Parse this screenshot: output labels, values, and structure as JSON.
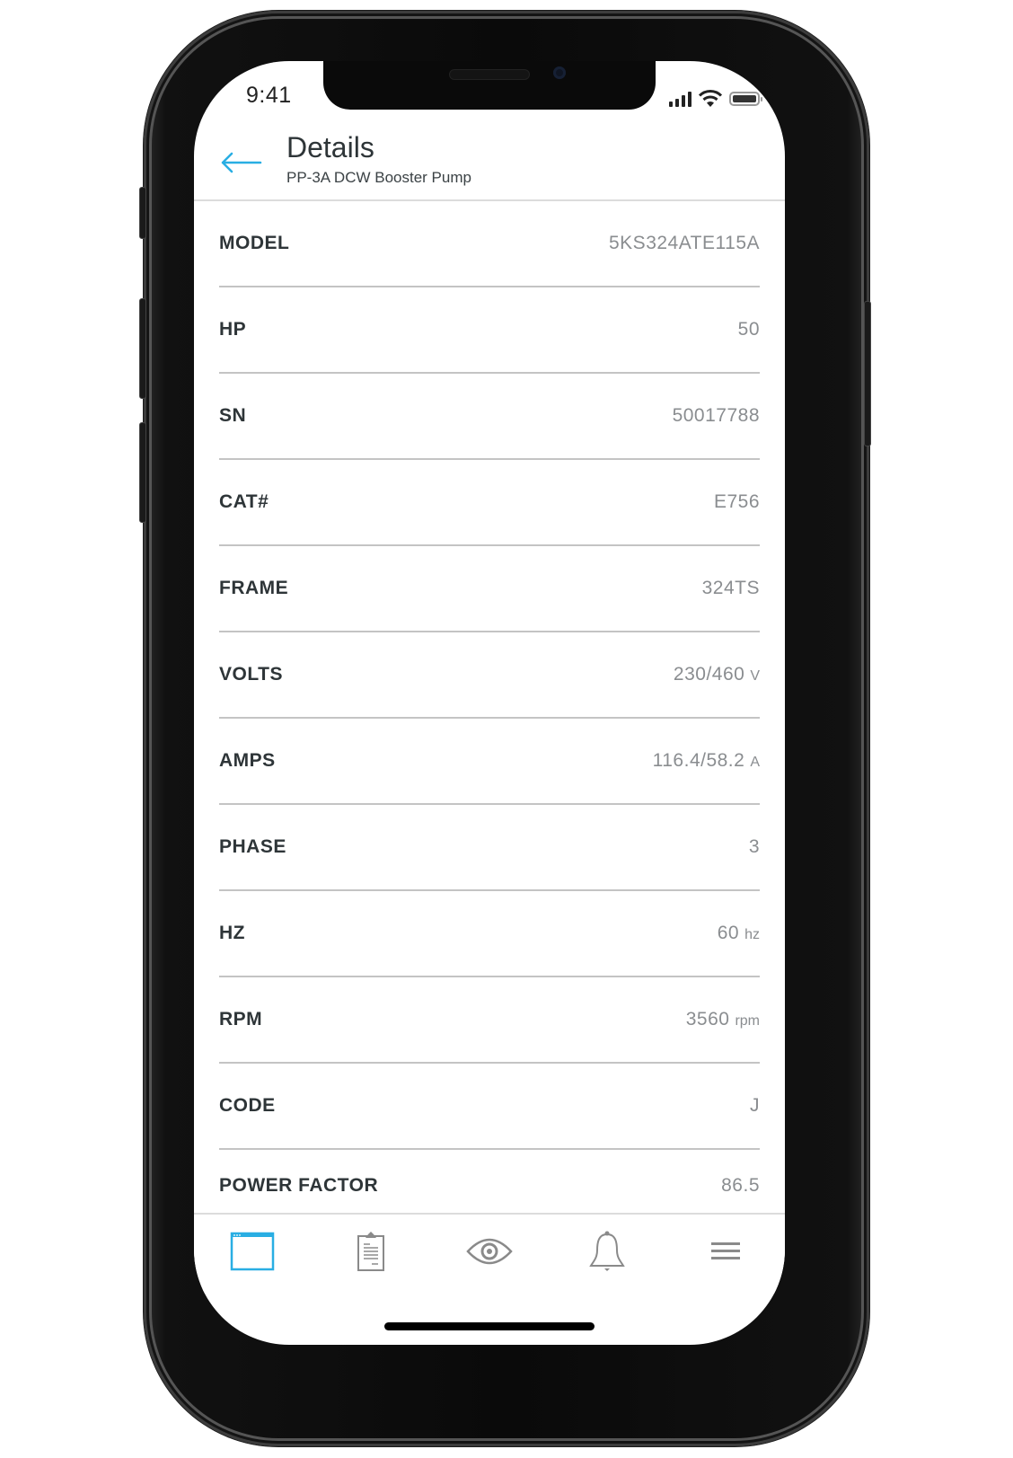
{
  "status_bar": {
    "time": "9:41",
    "icons": [
      "signal-icon",
      "wifi-icon",
      "battery-icon"
    ]
  },
  "header": {
    "back_icon": "arrow-left-icon",
    "title": "Details",
    "subtitle": "PP-3A DCW Booster Pump"
  },
  "details": [
    {
      "label": "MODEL",
      "value": "5KS324ATE115A",
      "unit": ""
    },
    {
      "label": "HP",
      "value": "50",
      "unit": ""
    },
    {
      "label": "SN",
      "value": "50017788",
      "unit": ""
    },
    {
      "label": "CAT#",
      "value": "E756",
      "unit": ""
    },
    {
      "label": "FRAME",
      "value": "324TS",
      "unit": ""
    },
    {
      "label": "VOLTS",
      "value": "230/460",
      "unit": "V"
    },
    {
      "label": "AMPS",
      "value": "116.4/58.2",
      "unit": "A"
    },
    {
      "label": "PHASE",
      "value": "3",
      "unit": ""
    },
    {
      "label": "HZ",
      "value": "60",
      "unit": "hz"
    },
    {
      "label": "RPM",
      "value": "3560",
      "unit": "rpm"
    },
    {
      "label": "CODE",
      "value": "J",
      "unit": ""
    },
    {
      "label": "POWER FACTOR",
      "value": "86.5",
      "unit": ""
    }
  ],
  "tabbar": {
    "tabs": [
      {
        "icon": "window-icon",
        "active": true
      },
      {
        "icon": "clipboard-icon",
        "active": false
      },
      {
        "icon": "eye-icon",
        "active": false
      },
      {
        "icon": "bell-icon",
        "active": false
      },
      {
        "icon": "menu-icon",
        "active": false
      }
    ]
  },
  "colors": {
    "accent": "#29aee3",
    "label": "#2e3538",
    "value": "#8a8d90",
    "icon_inactive": "#8a8a8a"
  }
}
